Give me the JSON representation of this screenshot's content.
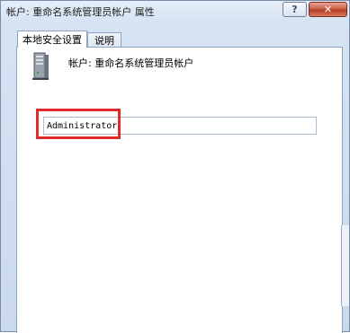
{
  "window": {
    "title": "帐户: 重命名系统管理员帐户 属性",
    "help_label": "?",
    "close_label": "✕"
  },
  "tabs": [
    {
      "label": "本地安全设置",
      "active": true
    },
    {
      "label": "说明",
      "active": false
    }
  ],
  "policy": {
    "icon": "server-icon",
    "name": "帐户: 重命名系统管理员帐户"
  },
  "account_field": {
    "value": "Administrator"
  },
  "colors": {
    "highlight": "#e02b2b",
    "close_button": "#c85a41"
  }
}
